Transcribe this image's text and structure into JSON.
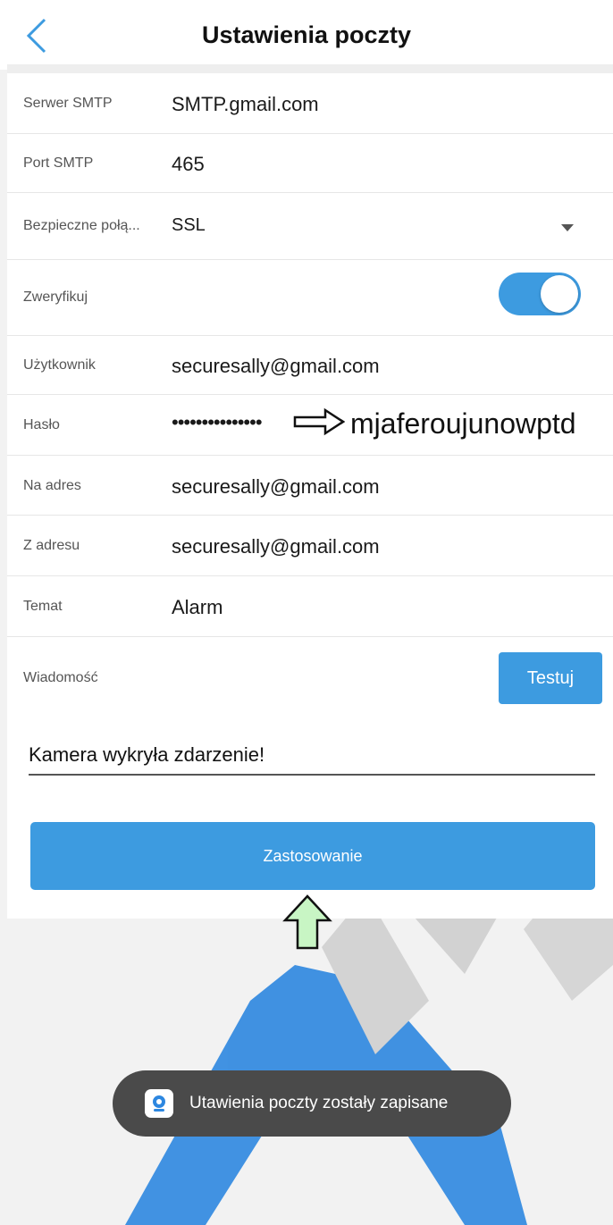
{
  "header": {
    "title": "Ustawienia poczty"
  },
  "form": {
    "smtp_server": {
      "label": "Serwer SMTP",
      "value": "SMTP.gmail.com"
    },
    "smtp_port": {
      "label": "Port SMTP",
      "value": "465"
    },
    "secure_connection": {
      "label": "Bezpieczne połą...",
      "value": "SSL"
    },
    "verify": {
      "label": "Zweryfikuj",
      "enabled": true
    },
    "user": {
      "label": "Użytkownik",
      "value": "securesally@gmail.com"
    },
    "password": {
      "label": "Hasło",
      "masked": "•••••••••••••••",
      "annotation": "mjaferoujunowptd"
    },
    "to_address": {
      "label": "Na adres",
      "value": "securesally@gmail.com"
    },
    "from_address": {
      "label": "Z adresu",
      "value": "securesally@gmail.com"
    },
    "subject": {
      "label": "Temat",
      "value": "Alarm"
    },
    "message": {
      "label": "Wiadomość",
      "value": "Kamera wykryła zdarzenie!"
    },
    "test_button": "Testuj",
    "apply_button": "Zastosowanie"
  },
  "toast": {
    "text": "Utawienia poczty zostały zapisane"
  },
  "colors": {
    "accent": "#3d9be0",
    "toast_bg": "#4a4a4a",
    "annotation_arrow_fill": "#c8f5c4"
  }
}
